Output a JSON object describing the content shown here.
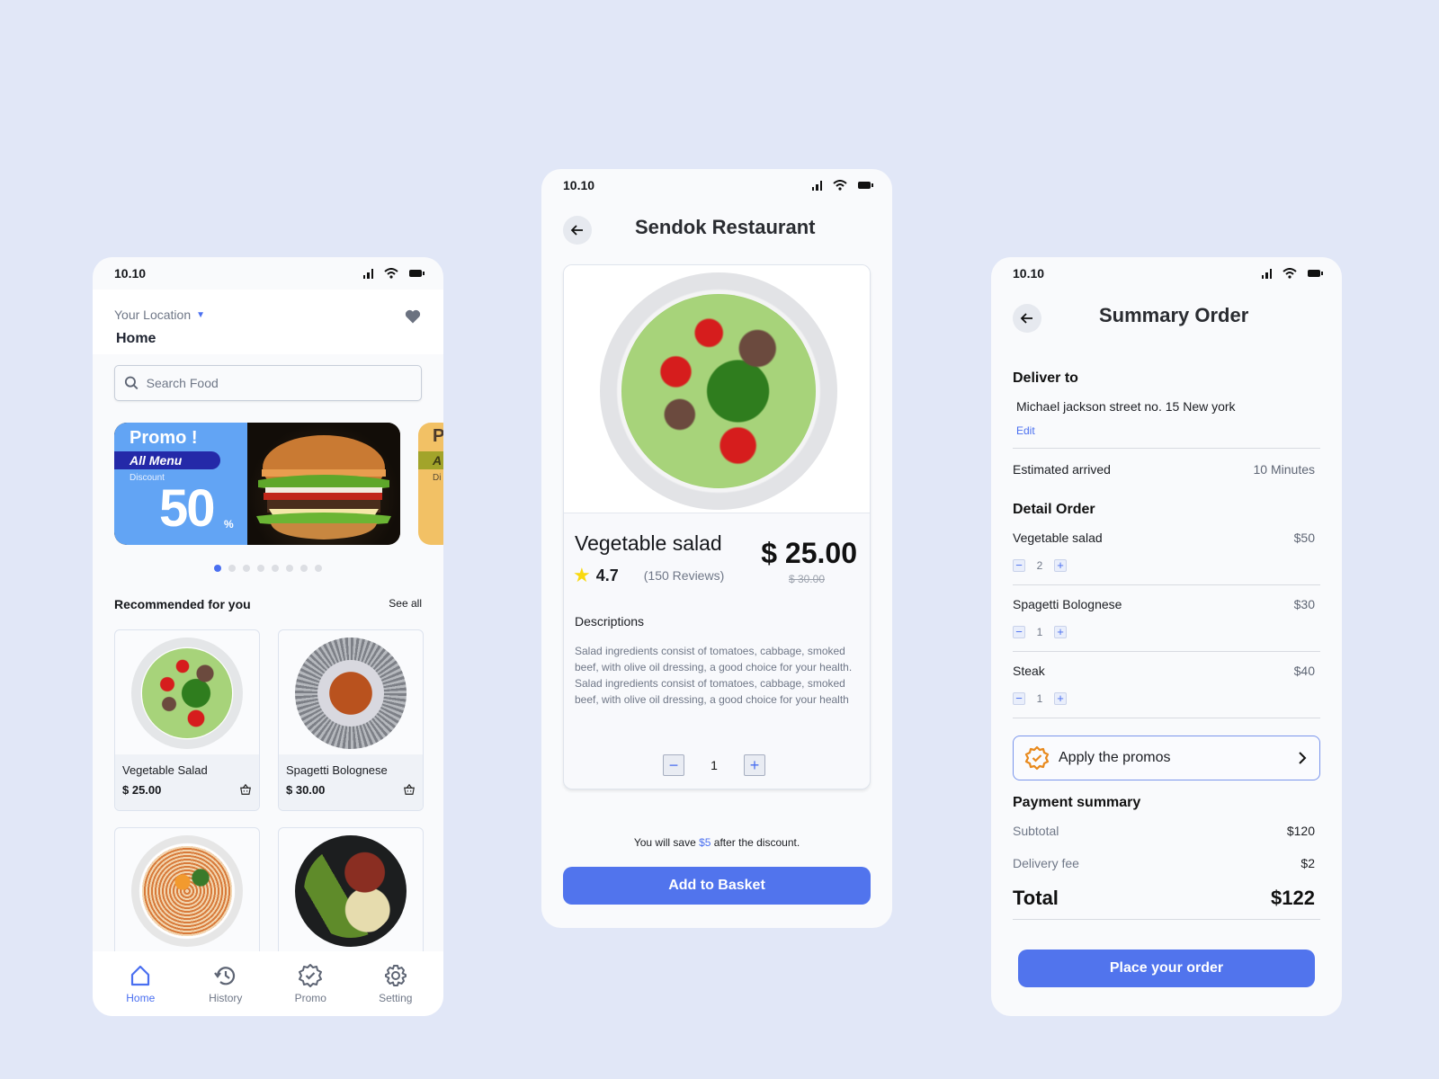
{
  "status_bar": {
    "time": "10.10"
  },
  "home": {
    "location_label": "Your Location",
    "location_value": "Home",
    "search_placeholder": "Search Food",
    "promo": {
      "title": "Promo !",
      "band": "All Menu",
      "discount_label": "Discount",
      "discount_value": "50",
      "percent": "%",
      "color": "#62a4f4"
    },
    "promo_next": {
      "title": "P",
      "band": "A",
      "discount_label": "Di",
      "color": "#f2c165"
    },
    "carousel": {
      "count": 8,
      "active_index": 0
    },
    "recommended_title": "Recommended for you",
    "see_all": "See all",
    "items": [
      {
        "name": "Vegetable Salad",
        "price": "$ 25.00"
      },
      {
        "name": "Spagetti Bolognese",
        "price": "$ 30.00"
      },
      {
        "name": "",
        "price": ""
      },
      {
        "name": "",
        "price": ""
      }
    ],
    "tabs": [
      {
        "label": "Home",
        "icon": "home-icon",
        "active": true
      },
      {
        "label": "History",
        "icon": "history-icon",
        "active": false
      },
      {
        "label": "Promo",
        "icon": "promo-badge-icon",
        "active": false
      },
      {
        "label": "Setting",
        "icon": "gear-icon",
        "active": false
      }
    ]
  },
  "detail": {
    "title": "Sendok Restaurant",
    "item_name": "Vegetable salad",
    "rating": "4.7",
    "reviews": "(150 Reviews)",
    "price": "$ 25.00",
    "old_price": "$ 30.00",
    "desc_title": "Descriptions",
    "description": "Salad ingredients consist of tomatoes, cabbage, smoked beef, with olive oil dressing, a good choice for your health. Salad ingredients consist of tomatoes, cabbage, smoked beef, with olive oil dressing, a good choice for your health",
    "quantity": "1",
    "save_prefix": "You will save ",
    "save_amount": "$5",
    "save_suffix": " after the discount.",
    "add_button": "Add to Basket"
  },
  "summary": {
    "title": "Summary Order",
    "deliver_title": "Deliver to",
    "address": "Michael jackson street no. 15 New york",
    "edit": "Edit",
    "eta_label": "Estimated arrived",
    "eta_value": "10 Minutes",
    "detail_title": "Detail Order",
    "orders": [
      {
        "name": "Vegetable salad",
        "price": "$50",
        "qty": "2"
      },
      {
        "name": "Spagetti Bolognese",
        "price": "$30",
        "qty": "1"
      },
      {
        "name": "Steak",
        "price": "$40",
        "qty": "1"
      }
    ],
    "promo_button": "Apply the promos",
    "payment_title": "Payment summary",
    "subtotal_label": "Subtotal",
    "subtotal_value": "$120",
    "delivery_label": "Delivery fee",
    "delivery_value": "$2",
    "total_label": "Total",
    "total_value": "$122",
    "place_order": "Place your order"
  },
  "colors": {
    "accent": "#5174ed",
    "background": "#e1e7f7",
    "star": "#f9d90f",
    "promo_badge": "#e8891c"
  }
}
